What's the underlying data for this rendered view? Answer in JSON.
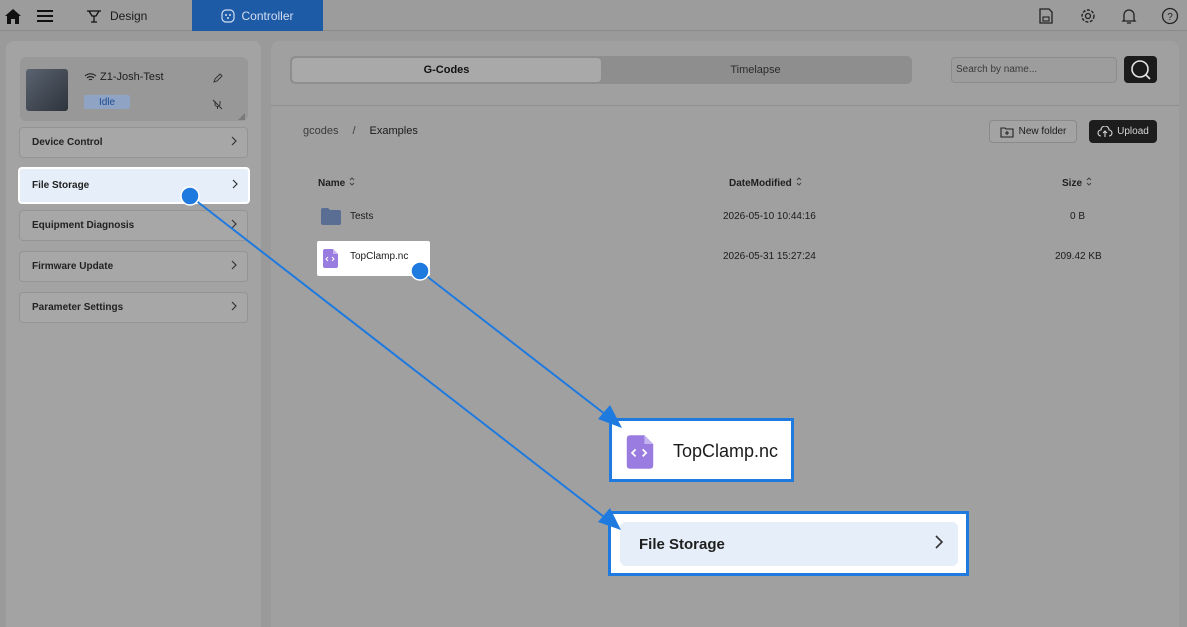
{
  "topbar": {
    "design_label": "Design",
    "controller_label": "Controller"
  },
  "sidebar": {
    "device": {
      "name": "Z1-Josh-Test",
      "status": "Idle"
    },
    "items": [
      {
        "label": "Device Control"
      },
      {
        "label": "File Storage"
      },
      {
        "label": "Equipment Diagnosis"
      },
      {
        "label": "Firmware Update"
      },
      {
        "label": "Parameter Settings"
      }
    ]
  },
  "main": {
    "tabs": [
      {
        "label": "G-Codes"
      },
      {
        "label": "Timelapse"
      }
    ],
    "search": {
      "placeholder": "Search by name..."
    },
    "breadcrumb": {
      "root": "gcodes",
      "separator": "/",
      "current": "Examples"
    },
    "new_folder_label": "New folder",
    "upload_label": "Upload",
    "table": {
      "headers": [
        "Name",
        "DateModified",
        "Size"
      ],
      "rows": [
        {
          "name": "Tests",
          "date": "2026-05-10 10:44:16",
          "size": "0 B"
        },
        {
          "name": "TopClamp.nc",
          "date": "2026-05-31 15:27:24",
          "size": "209.42 KB"
        }
      ]
    }
  },
  "callouts": {
    "file_label": "TopClamp.nc",
    "menu_label": "File Storage"
  },
  "colors": {
    "accent": "#1e5ba7",
    "annotation": "#1f7ae0",
    "active_menu": "#e6eef9",
    "file_icon": "#8a63d2"
  }
}
